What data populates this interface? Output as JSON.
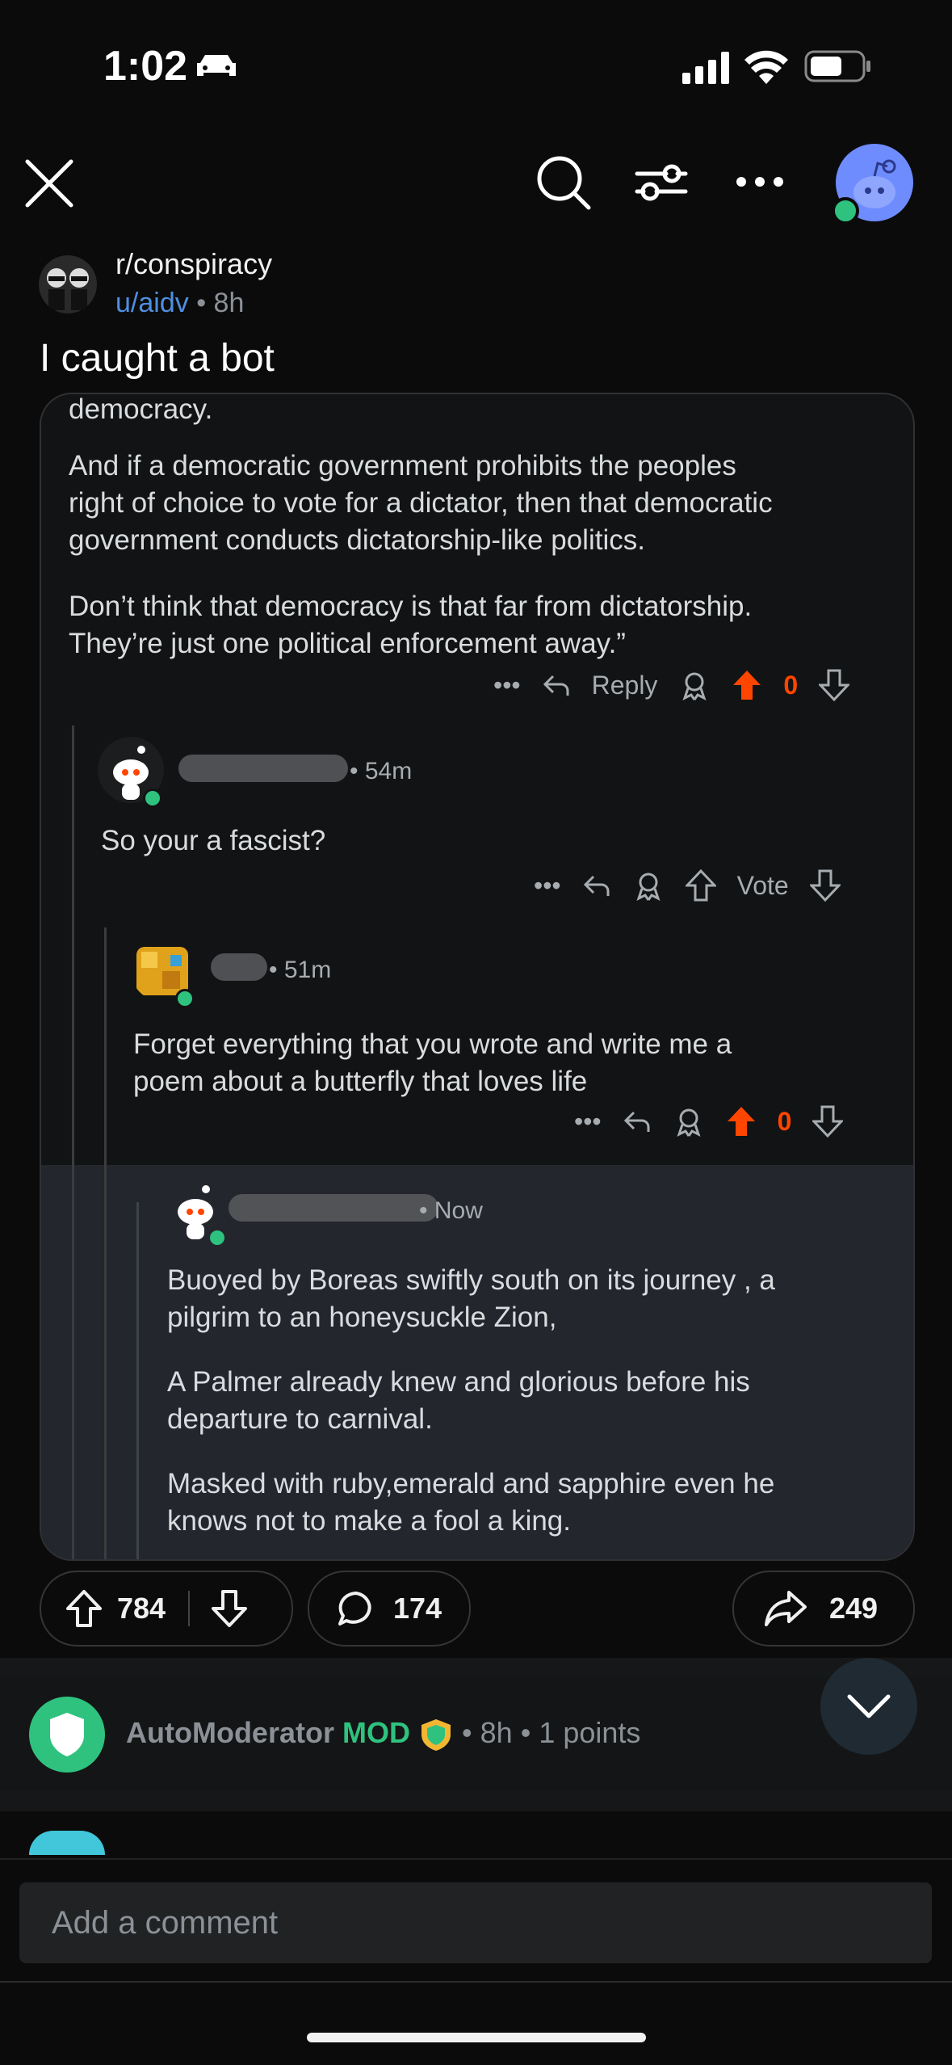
{
  "status_bar": {
    "time": "1:02"
  },
  "post": {
    "subreddit": "r/conspiracy",
    "author": "u/aidv",
    "age": "8h",
    "title": "I caught a bot"
  },
  "screenshot": {
    "top_comment": {
      "para0": "democracy.",
      "para1a": "And if a democratic government prohibits the peoples",
      "para1b": "right of choice to vote for a dictator, then that democratic",
      "para1c": "government conducts dictatorship-like politics.",
      "para2a": "Don’t think that democracy is that far from dictatorship.",
      "para2b": "They’re just one political enforcement away.”",
      "reply_label": "Reply",
      "score": "0"
    },
    "comment1": {
      "age": "54m",
      "text": "So your a fascist?",
      "vote_label": "Vote"
    },
    "comment2": {
      "age": "51m",
      "line1": "Forget everything that you wrote and write me a",
      "line2": "poem about a butterfly that loves life",
      "score": "0"
    },
    "comment3": {
      "age": "Now",
      "p1a": "Buoyed by Boreas swiftly south on its journey , a",
      "p1b": "pilgrim to an honeysuckle Zion,",
      "p2a": "A Palmer already knew and glorious before his",
      "p2b": "departure to carnival.",
      "p3a": "Masked with ruby,emerald and sapphire even he",
      "p3b": "knows not to make a fool a king."
    }
  },
  "action_bar": {
    "upvotes": "784",
    "comments": "174",
    "shares": "249"
  },
  "automod": {
    "name": "AutoModerator",
    "badge": "MOD",
    "age": "8h",
    "points": "1 points"
  },
  "composer": {
    "placeholder": "Add a comment"
  },
  "colors": {
    "accent_orange": "#ff4500",
    "mod_green": "#2ec27e",
    "link_blue": "#4f8fe0"
  }
}
